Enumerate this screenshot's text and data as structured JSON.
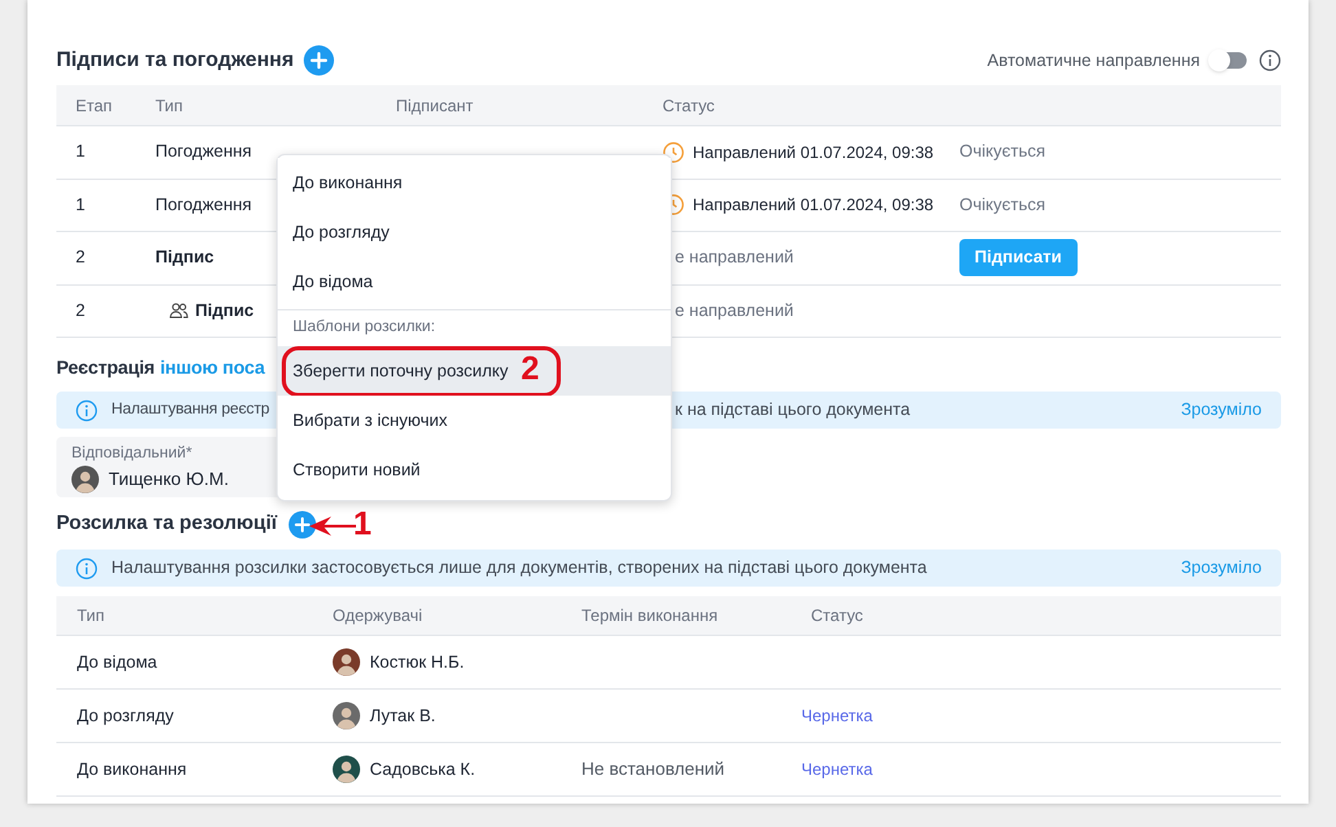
{
  "signatures": {
    "title": "Підписи та погодження",
    "auto_send": {
      "label": "Автоматичне направлення",
      "on": false
    },
    "columns": [
      "Етап",
      "Тип",
      "Підписант",
      "Статус"
    ],
    "rows": [
      {
        "stage": "1",
        "type": "Погодження",
        "kind": "single",
        "status": {
          "kind": "sent",
          "text": "Направлений 01.07.2024, 09:38"
        },
        "action": {
          "kind": "waiting",
          "text": "Очікується"
        }
      },
      {
        "stage": "1",
        "type": "Погодження",
        "kind": "single",
        "status": {
          "kind": "sent",
          "text": "Направлений 01.07.2024, 09:38"
        },
        "action": {
          "kind": "waiting",
          "text": "Очікується"
        }
      },
      {
        "stage": "2",
        "type": "Підпис",
        "kind": "single",
        "status": {
          "kind": "not_sent",
          "text": "е направлений"
        },
        "action": {
          "kind": "button",
          "text": "Підписати"
        }
      },
      {
        "stage": "2",
        "type": "Підпис",
        "kind": "group",
        "status": {
          "kind": "not_sent",
          "text": "е направлений"
        }
      }
    ]
  },
  "registration": {
    "title": "Реєстрація",
    "link": "іншою поса",
    "banner": {
      "left": "Налаштування реєстр",
      "right": "к на підставі цього документа",
      "action": "Зрозуміло"
    },
    "responsible": {
      "label": "Відповідальний*",
      "name": "Тищенко Ю.М."
    }
  },
  "distribution": {
    "title": "Розсилка та резолюції",
    "banner": {
      "text": "Налаштування розсилки застосовується лише для документів, створених на підставі цього документа",
      "action": "Зрозуміло"
    },
    "columns": [
      "Тип",
      "Одержувачі",
      "Термін виконання",
      "Статус"
    ],
    "rows": [
      {
        "type": "До відома",
        "recipient": "Костюк Н.Б."
      },
      {
        "type": "До розгляду",
        "recipient": "Лутак В.",
        "status": {
          "kind": "draft",
          "text": "Чернетка"
        }
      },
      {
        "type": "До виконання",
        "recipient": "Садовська К.",
        "deadline": "Не встановлений",
        "status": {
          "kind": "draft",
          "text": "Чернетка"
        }
      }
    ]
  },
  "menu": {
    "items": [
      {
        "kind": "item",
        "label": "До виконання",
        "selected": false
      },
      {
        "kind": "item",
        "label": "До розгляду",
        "selected": false
      },
      {
        "kind": "item",
        "label": "До відома",
        "selected": false
      },
      {
        "kind": "heading",
        "label": "Шаблони розсилки:"
      },
      {
        "kind": "item",
        "label": "Зберегти поточну розсилку",
        "selected": true
      },
      {
        "kind": "item",
        "label": "Вибрати з існуючих",
        "selected": false
      },
      {
        "kind": "item",
        "label": "Створити новий",
        "selected": false
      }
    ]
  },
  "annotations": {
    "add_button": "1",
    "menu_item": "2"
  }
}
